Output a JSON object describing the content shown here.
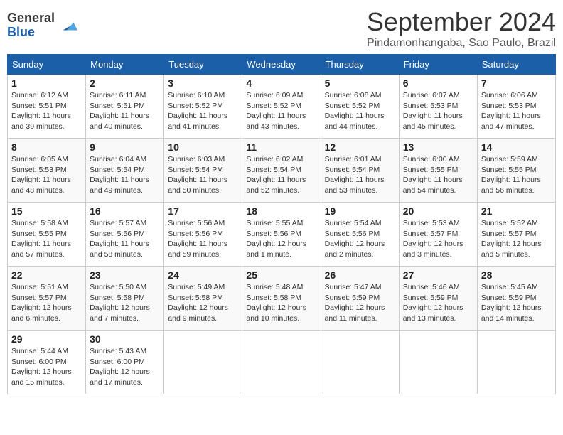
{
  "header": {
    "logo_general": "General",
    "logo_blue": "Blue",
    "month_title": "September 2024",
    "location": "Pindamonhangaba, Sao Paulo, Brazil"
  },
  "days_of_week": [
    "Sunday",
    "Monday",
    "Tuesday",
    "Wednesday",
    "Thursday",
    "Friday",
    "Saturday"
  ],
  "weeks": [
    [
      {
        "num": "1",
        "sunrise": "6:12 AM",
        "sunset": "5:51 PM",
        "daylight": "11 hours and 39 minutes."
      },
      {
        "num": "2",
        "sunrise": "6:11 AM",
        "sunset": "5:51 PM",
        "daylight": "11 hours and 40 minutes."
      },
      {
        "num": "3",
        "sunrise": "6:10 AM",
        "sunset": "5:52 PM",
        "daylight": "11 hours and 41 minutes."
      },
      {
        "num": "4",
        "sunrise": "6:09 AM",
        "sunset": "5:52 PM",
        "daylight": "11 hours and 43 minutes."
      },
      {
        "num": "5",
        "sunrise": "6:08 AM",
        "sunset": "5:52 PM",
        "daylight": "11 hours and 44 minutes."
      },
      {
        "num": "6",
        "sunrise": "6:07 AM",
        "sunset": "5:53 PM",
        "daylight": "11 hours and 45 minutes."
      },
      {
        "num": "7",
        "sunrise": "6:06 AM",
        "sunset": "5:53 PM",
        "daylight": "11 hours and 47 minutes."
      }
    ],
    [
      {
        "num": "8",
        "sunrise": "6:05 AM",
        "sunset": "5:53 PM",
        "daylight": "11 hours and 48 minutes."
      },
      {
        "num": "9",
        "sunrise": "6:04 AM",
        "sunset": "5:54 PM",
        "daylight": "11 hours and 49 minutes."
      },
      {
        "num": "10",
        "sunrise": "6:03 AM",
        "sunset": "5:54 PM",
        "daylight": "11 hours and 50 minutes."
      },
      {
        "num": "11",
        "sunrise": "6:02 AM",
        "sunset": "5:54 PM",
        "daylight": "11 hours and 52 minutes."
      },
      {
        "num": "12",
        "sunrise": "6:01 AM",
        "sunset": "5:54 PM",
        "daylight": "11 hours and 53 minutes."
      },
      {
        "num": "13",
        "sunrise": "6:00 AM",
        "sunset": "5:55 PM",
        "daylight": "11 hours and 54 minutes."
      },
      {
        "num": "14",
        "sunrise": "5:59 AM",
        "sunset": "5:55 PM",
        "daylight": "11 hours and 56 minutes."
      }
    ],
    [
      {
        "num": "15",
        "sunrise": "5:58 AM",
        "sunset": "5:55 PM",
        "daylight": "11 hours and 57 minutes."
      },
      {
        "num": "16",
        "sunrise": "5:57 AM",
        "sunset": "5:56 PM",
        "daylight": "11 hours and 58 minutes."
      },
      {
        "num": "17",
        "sunrise": "5:56 AM",
        "sunset": "5:56 PM",
        "daylight": "11 hours and 59 minutes."
      },
      {
        "num": "18",
        "sunrise": "5:55 AM",
        "sunset": "5:56 PM",
        "daylight": "12 hours and 1 minute."
      },
      {
        "num": "19",
        "sunrise": "5:54 AM",
        "sunset": "5:56 PM",
        "daylight": "12 hours and 2 minutes."
      },
      {
        "num": "20",
        "sunrise": "5:53 AM",
        "sunset": "5:57 PM",
        "daylight": "12 hours and 3 minutes."
      },
      {
        "num": "21",
        "sunrise": "5:52 AM",
        "sunset": "5:57 PM",
        "daylight": "12 hours and 5 minutes."
      }
    ],
    [
      {
        "num": "22",
        "sunrise": "5:51 AM",
        "sunset": "5:57 PM",
        "daylight": "12 hours and 6 minutes."
      },
      {
        "num": "23",
        "sunrise": "5:50 AM",
        "sunset": "5:58 PM",
        "daylight": "12 hours and 7 minutes."
      },
      {
        "num": "24",
        "sunrise": "5:49 AM",
        "sunset": "5:58 PM",
        "daylight": "12 hours and 9 minutes."
      },
      {
        "num": "25",
        "sunrise": "5:48 AM",
        "sunset": "5:58 PM",
        "daylight": "12 hours and 10 minutes."
      },
      {
        "num": "26",
        "sunrise": "5:47 AM",
        "sunset": "5:59 PM",
        "daylight": "12 hours and 11 minutes."
      },
      {
        "num": "27",
        "sunrise": "5:46 AM",
        "sunset": "5:59 PM",
        "daylight": "12 hours and 13 minutes."
      },
      {
        "num": "28",
        "sunrise": "5:45 AM",
        "sunset": "5:59 PM",
        "daylight": "12 hours and 14 minutes."
      }
    ],
    [
      {
        "num": "29",
        "sunrise": "5:44 AM",
        "sunset": "6:00 PM",
        "daylight": "12 hours and 15 minutes."
      },
      {
        "num": "30",
        "sunrise": "5:43 AM",
        "sunset": "6:00 PM",
        "daylight": "12 hours and 17 minutes."
      },
      null,
      null,
      null,
      null,
      null
    ]
  ]
}
